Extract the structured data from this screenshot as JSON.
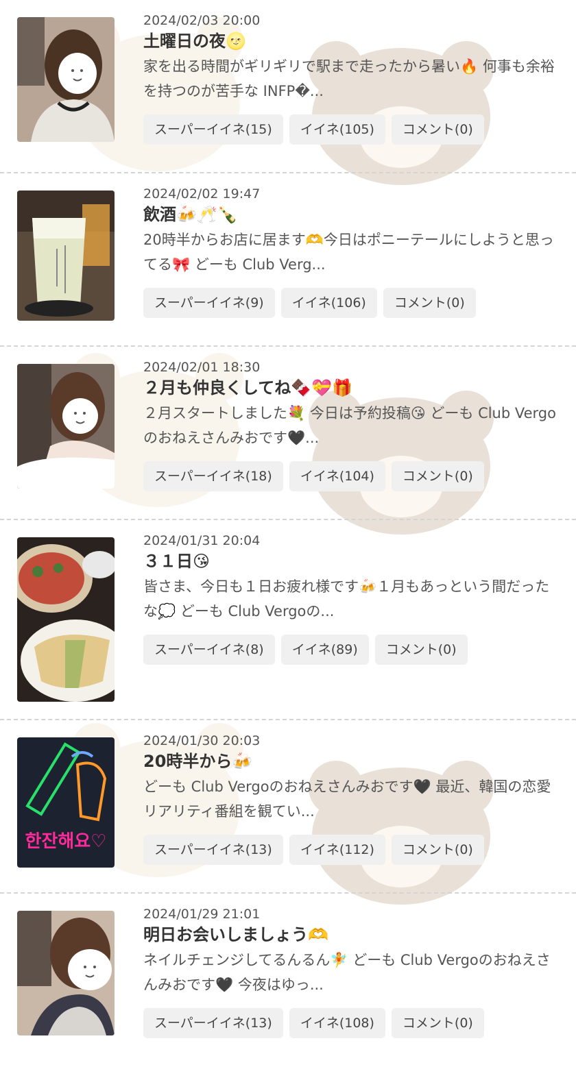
{
  "posts": [
    {
      "date": "2024/02/03 20:00",
      "title": "土曜日の夜🌝",
      "text": "家を出る時間がギリギリで駅まで走ったから暑い🔥 何事も余裕を持つのが苦手な INFP�...",
      "super_like": "スーパーイイネ(15)",
      "like": "イイネ(105)",
      "comment": "コメント(0)",
      "thumb": "woman-portrait"
    },
    {
      "date": "2024/02/02 19:47",
      "title": "飲酒🍻🥂🍾",
      "text": "20時半からお店に居ます🫶今日はポニーテールにしようと思ってる🎀 どーも Club Verg...",
      "super_like": "スーパーイイネ(9)",
      "like": "イイネ(106)",
      "comment": "コメント(0)",
      "thumb": "drink-glass"
    },
    {
      "date": "2024/02/01 18:30",
      "title": "２月も仲良くしてね🍫💝🎁",
      "text": "２月スタートしました💐 今日は予約投稿😘 どーも Club Vergoのおねえさんみおです🖤...",
      "super_like": "スーパーイイネ(18)",
      "like": "イイネ(104)",
      "comment": "コメント(0)",
      "thumb": "woman-portrait"
    },
    {
      "date": "2024/01/31 20:04",
      "title": "３１日😘",
      "text": "皆さま、今日も１日お疲れ様です🍻１月もあっという間だったな💭 どーも Club Vergoの...",
      "super_like": "スーパーイイネ(8)",
      "like": "イイネ(89)",
      "comment": "コメント(0)",
      "thumb": "food-plates"
    },
    {
      "date": "2024/01/30 20:03",
      "title": "20時半から🍻",
      "text": "どーも Club Vergoのおねえさんみおです🖤 最近、韓国の恋愛リアリティ番組を観てい...",
      "super_like": "スーパーイイネ(13)",
      "like": "イイネ(112)",
      "comment": "コメント(0)",
      "thumb": "neon-sign",
      "neon_text": "한잔해요♡"
    },
    {
      "date": "2024/01/29 21:01",
      "title": "明日お会いしましょう🫶",
      "text": "ネイルチェンジしてるんるん🧚 どーも Club Vergoのおねえさんみおです🖤 今夜はゆっ...",
      "super_like": "スーパーイイネ(13)",
      "like": "イイネ(108)",
      "comment": "コメント(0)",
      "thumb": "woman-portrait"
    }
  ]
}
